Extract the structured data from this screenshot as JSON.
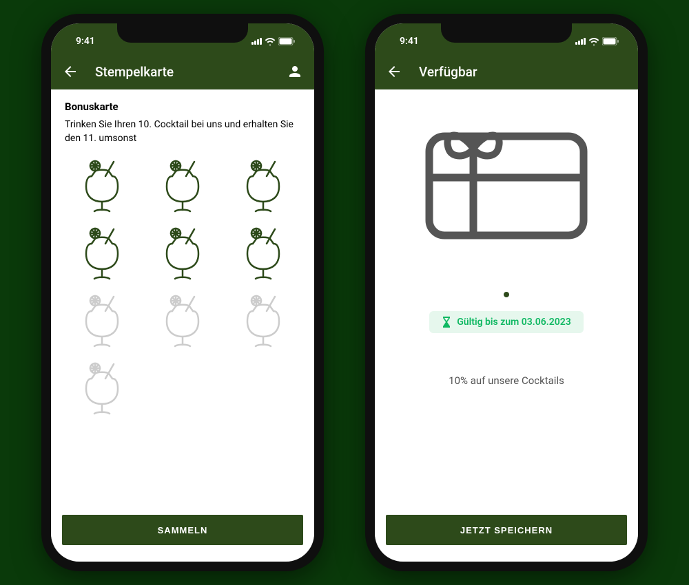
{
  "status": {
    "time": "9:41"
  },
  "phone1": {
    "headerTitle": "Stempelkarte",
    "bonusTitle": "Bonuskarte",
    "bonusDesc": "Trinken Sie Ihren 10. Cocktail bei uns und erhalten Sie den 11. umsonst",
    "buttonLabel": "SAMMELN",
    "stamps": {
      "total": 10,
      "collected": 6
    }
  },
  "phone2": {
    "headerTitle": "Verfügbar",
    "validityText": "Gültig bis zum 03.06.2023",
    "discountText": "10% auf unsere Cocktails",
    "buttonLabel": "JETZT SPEICHERN"
  },
  "colors": {
    "brand": "#2d4a1a",
    "active": "#2d4a1a",
    "inactive": "#cccccc",
    "badgeBg": "#e6f7ed",
    "badgeText": "#0fb862"
  }
}
